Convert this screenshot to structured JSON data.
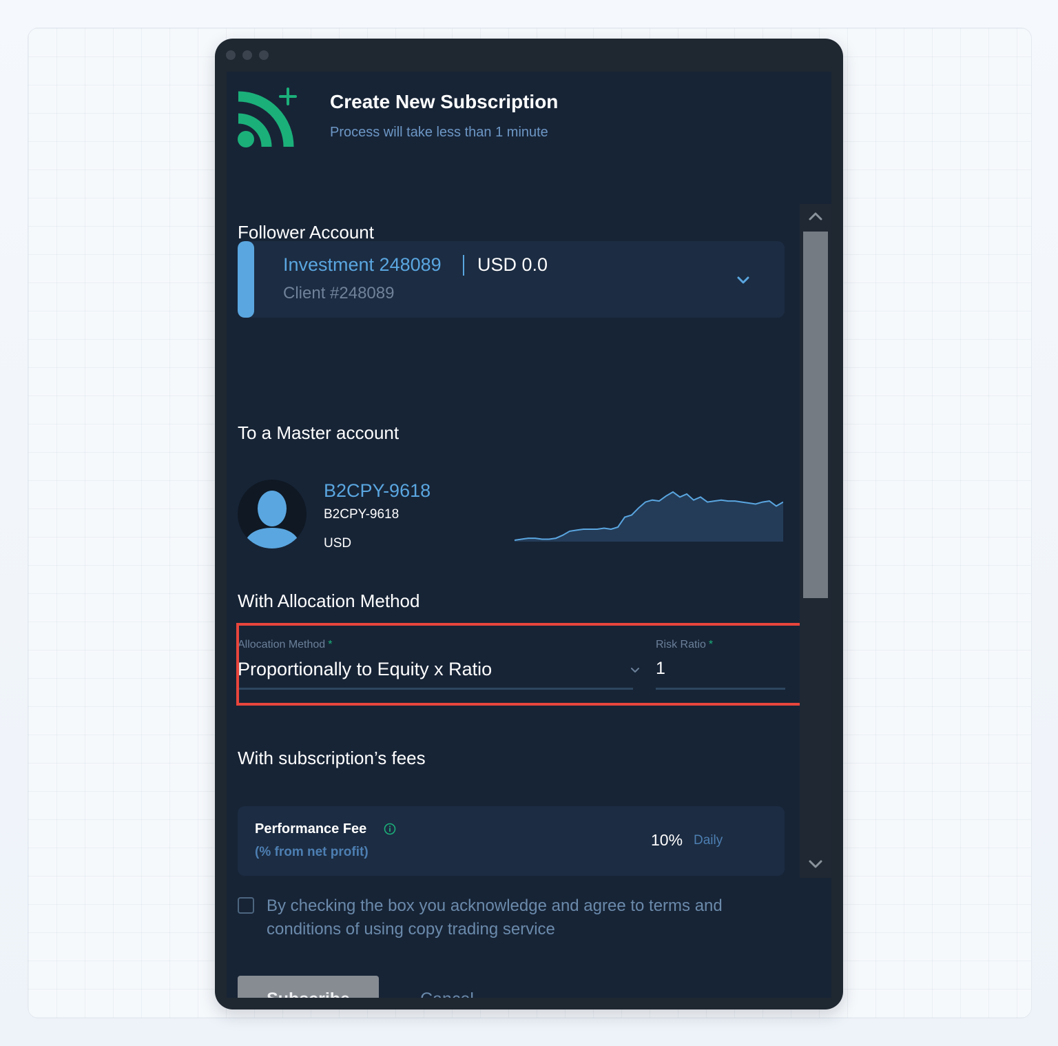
{
  "dialog": {
    "title": "Create New Subscription",
    "subtitle": "Process will take less than 1 minute"
  },
  "follower": {
    "heading": "Follower Account",
    "account_name": "Investment 248089",
    "balance": "USD 0.0",
    "client": "Client #248089"
  },
  "master": {
    "heading": "To a Master account",
    "name": "B2CPY-9618",
    "id": "B2CPY-9618",
    "currency": "USD",
    "sparkline": [
      12,
      13,
      14,
      14,
      13,
      13,
      14,
      17,
      21,
      22,
      23,
      23,
      23,
      24,
      23,
      25,
      35,
      37,
      44,
      50,
      52,
      51,
      56,
      60,
      55,
      58,
      52,
      55,
      50,
      51,
      52,
      51,
      51,
      50,
      49,
      48,
      50,
      51,
      46,
      50
    ]
  },
  "allocation": {
    "heading": "With Allocation Method",
    "method_label": "Allocation Method",
    "method_value": "Proportionally to Equity x Ratio",
    "ratio_label": "Risk Ratio",
    "ratio_value": "1",
    "required_mark": "*"
  },
  "fees": {
    "heading": "With subscription’s fees",
    "performance_title": "Performance Fee",
    "performance_sub": "(% from net profit)",
    "performance_value": "10%",
    "performance_period": "Daily"
  },
  "terms": {
    "text": "By checking the box you acknowledge and agree to terms and conditions of using copy trading service",
    "checked": false
  },
  "actions": {
    "subscribe": "Subscribe",
    "cancel": "Cancel"
  },
  "colors": {
    "accent_blue": "#5aa6e0",
    "brand_green": "#1bb07a",
    "highlight_red": "#e8453c",
    "panel_bg": "#172436"
  },
  "icons": {
    "logo": "rss-plus-icon",
    "account_dropdown": "chevron-down-icon",
    "avatar": "user-avatar-icon",
    "info": "info-icon",
    "scroll_up": "chevron-up-icon",
    "scroll_down": "chevron-down-icon"
  }
}
